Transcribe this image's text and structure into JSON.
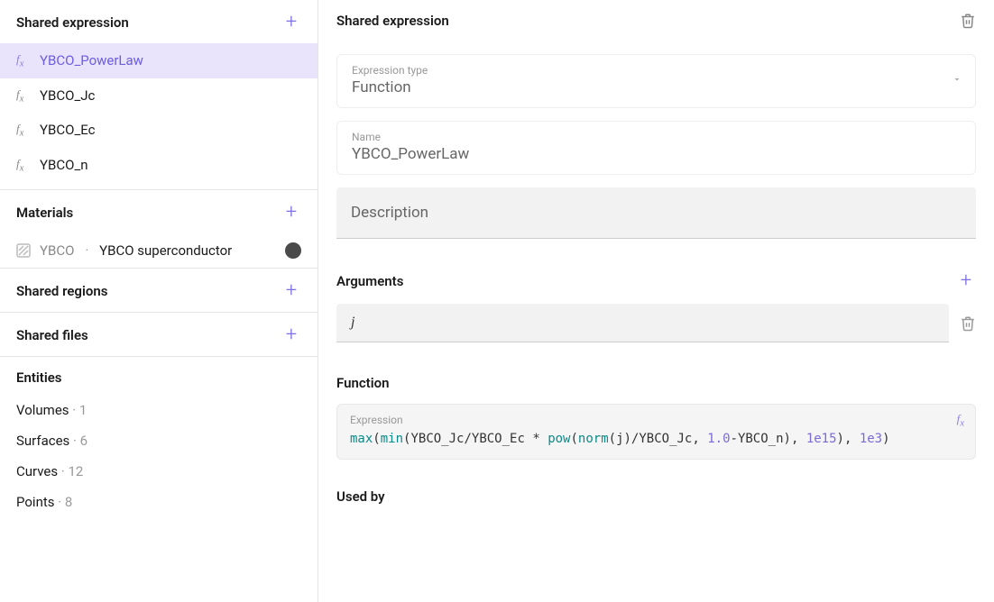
{
  "sidebar": {
    "shared_expression": {
      "title": "Shared expression",
      "items": [
        {
          "label": "YBCO_PowerLaw",
          "selected": true
        },
        {
          "label": "YBCO_Jc",
          "selected": false
        },
        {
          "label": "YBCO_Ec",
          "selected": false
        },
        {
          "label": "YBCO_n",
          "selected": false
        }
      ]
    },
    "materials": {
      "title": "Materials",
      "items": [
        {
          "name": "YBCO",
          "desc": "YBCO superconductor",
          "swatch": "#4a4a4a"
        }
      ]
    },
    "shared_regions": {
      "title": "Shared regions"
    },
    "shared_files": {
      "title": "Shared files"
    },
    "entities": {
      "title": "Entities",
      "rows": [
        {
          "label": "Volumes",
          "count": 1
        },
        {
          "label": "Surfaces",
          "count": 6
        },
        {
          "label": "Curves",
          "count": 12
        },
        {
          "label": "Points",
          "count": 8
        }
      ]
    }
  },
  "main": {
    "title": "Shared expression",
    "type_label": "Expression type",
    "type_value": "Function",
    "name_label": "Name",
    "name_value": "YBCO_PowerLaw",
    "description_placeholder": "Description",
    "arguments_title": "Arguments",
    "arguments": [
      "j"
    ],
    "function_title": "Function",
    "expression_label": "Expression",
    "expression_tokens": [
      {
        "t": "fn",
        "v": "max"
      },
      {
        "t": "p",
        "v": "("
      },
      {
        "t": "fn",
        "v": "min"
      },
      {
        "t": "p",
        "v": "(YBCO_Jc/YBCO_Ec * "
      },
      {
        "t": "fn",
        "v": "pow"
      },
      {
        "t": "p",
        "v": "("
      },
      {
        "t": "fn",
        "v": "norm"
      },
      {
        "t": "p",
        "v": "(j)/YBCO_Jc, "
      },
      {
        "t": "num",
        "v": "1.0"
      },
      {
        "t": "p",
        "v": "-YBCO_n), "
      },
      {
        "t": "num",
        "v": "1e15"
      },
      {
        "t": "p",
        "v": "), "
      },
      {
        "t": "num",
        "v": "1e3"
      },
      {
        "t": "p",
        "v": ")"
      }
    ],
    "usedby_title": "Used by"
  }
}
